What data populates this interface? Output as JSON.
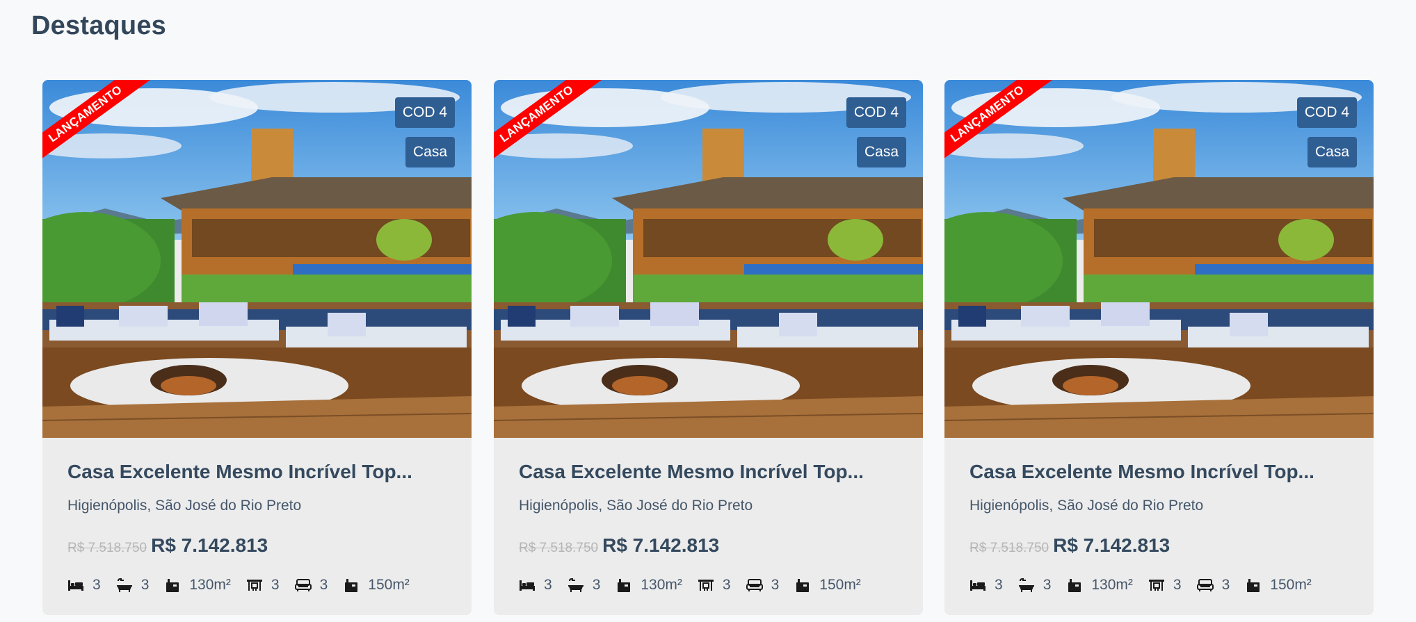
{
  "section": {
    "title": "Destaques"
  },
  "colors": {
    "ribbon": "#ff0000",
    "badge": "#2f5e93",
    "card_bg": "#ececec",
    "page_bg": "#f8f9fa"
  },
  "cards": [
    {
      "ribbon": "LANÇAMENTO",
      "code": "COD 4",
      "type": "Casa",
      "title": "Casa Excelente Mesmo Incrível Top...",
      "location": "Higienópolis, São José do Rio Preto",
      "old_price": "R$ 7.518.750",
      "price": "R$ 7.142.813",
      "features": [
        {
          "icon": "bed-icon",
          "value": "3"
        },
        {
          "icon": "bathtub-icon",
          "value": "3"
        },
        {
          "icon": "area-icon",
          "value": "130m²"
        },
        {
          "icon": "parking-icon",
          "value": "3"
        },
        {
          "icon": "sofa-icon",
          "value": "3"
        },
        {
          "icon": "total-area-icon",
          "value": "150m²"
        }
      ]
    },
    {
      "ribbon": "LANÇAMENTO",
      "code": "COD 4",
      "type": "Casa",
      "title": "Casa Excelente Mesmo Incrível Top...",
      "location": "Higienópolis, São José do Rio Preto",
      "old_price": "R$ 7.518.750",
      "price": "R$ 7.142.813",
      "features": [
        {
          "icon": "bed-icon",
          "value": "3"
        },
        {
          "icon": "bathtub-icon",
          "value": "3"
        },
        {
          "icon": "area-icon",
          "value": "130m²"
        },
        {
          "icon": "parking-icon",
          "value": "3"
        },
        {
          "icon": "sofa-icon",
          "value": "3"
        },
        {
          "icon": "total-area-icon",
          "value": "150m²"
        }
      ]
    },
    {
      "ribbon": "LANÇAMENTO",
      "code": "COD 4",
      "type": "Casa",
      "title": "Casa Excelente Mesmo Incrível Top...",
      "location": "Higienópolis, São José do Rio Preto",
      "old_price": "R$ 7.518.750",
      "price": "R$ 7.142.813",
      "features": [
        {
          "icon": "bed-icon",
          "value": "3"
        },
        {
          "icon": "bathtub-icon",
          "value": "3"
        },
        {
          "icon": "area-icon",
          "value": "130m²"
        },
        {
          "icon": "parking-icon",
          "value": "3"
        },
        {
          "icon": "sofa-icon",
          "value": "3"
        },
        {
          "icon": "total-area-icon",
          "value": "150m²"
        }
      ]
    }
  ]
}
